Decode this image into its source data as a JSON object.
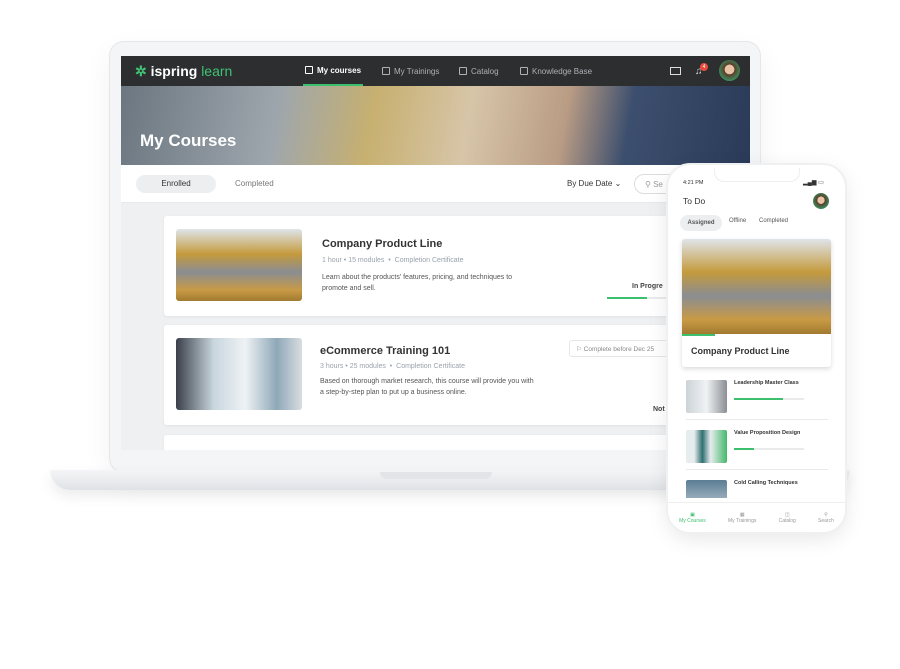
{
  "laptop": {
    "logo": {
      "brand": "ispring",
      "product": "learn"
    },
    "nav": [
      {
        "label": "My courses",
        "icon": "book-icon",
        "active": true
      },
      {
        "label": "My Trainings",
        "icon": "calendar-icon"
      },
      {
        "label": "Catalog",
        "icon": "catalog-icon"
      },
      {
        "label": "Knowledge Base",
        "icon": "info-icon"
      }
    ],
    "notifications": "4",
    "page_title": "My Courses",
    "tabs": [
      "Enrolled",
      "Completed"
    ],
    "sort_label": "By Due Date",
    "search_placeholder": "Se",
    "courses": [
      {
        "title": "Company Product Line",
        "duration": "1 hour",
        "modules": "15 modules",
        "certificate": "Completion Certificate",
        "description": "Learn about the products' features, pricing, and techniques to promote and sell.",
        "status": "In Progre",
        "progress_percent": 60
      },
      {
        "title": "eCommerce Training 101",
        "duration": "3 hours",
        "modules": "25 modules",
        "certificate": "Completion Certificate",
        "description": "Based on thorough market research, this course will provide you with a step-by-step plan to put up a business online.",
        "deadline": "Complete before Dec 25",
        "status": "Not"
      }
    ]
  },
  "phone": {
    "time": "4:21 PM",
    "title": "To Do",
    "tabs": [
      "Assigned",
      "Offline",
      "Completed"
    ],
    "featured": {
      "title": "Company Product Line",
      "progress_percent": 22
    },
    "items": [
      {
        "title": "Leadership Master Class",
        "progress_percent": 70
      },
      {
        "title": "Value Proposition Design",
        "progress_percent": 28
      },
      {
        "title": "Cold Calling Techniques"
      }
    ],
    "tabbar": [
      {
        "label": "My Courses",
        "active": true
      },
      {
        "label": "My Trainings"
      },
      {
        "label": "Catalog"
      },
      {
        "label": "Search"
      }
    ]
  },
  "colors": {
    "accent": "#3cc06e",
    "topbar": "#2c2e30",
    "badge": "#e84a3c"
  }
}
